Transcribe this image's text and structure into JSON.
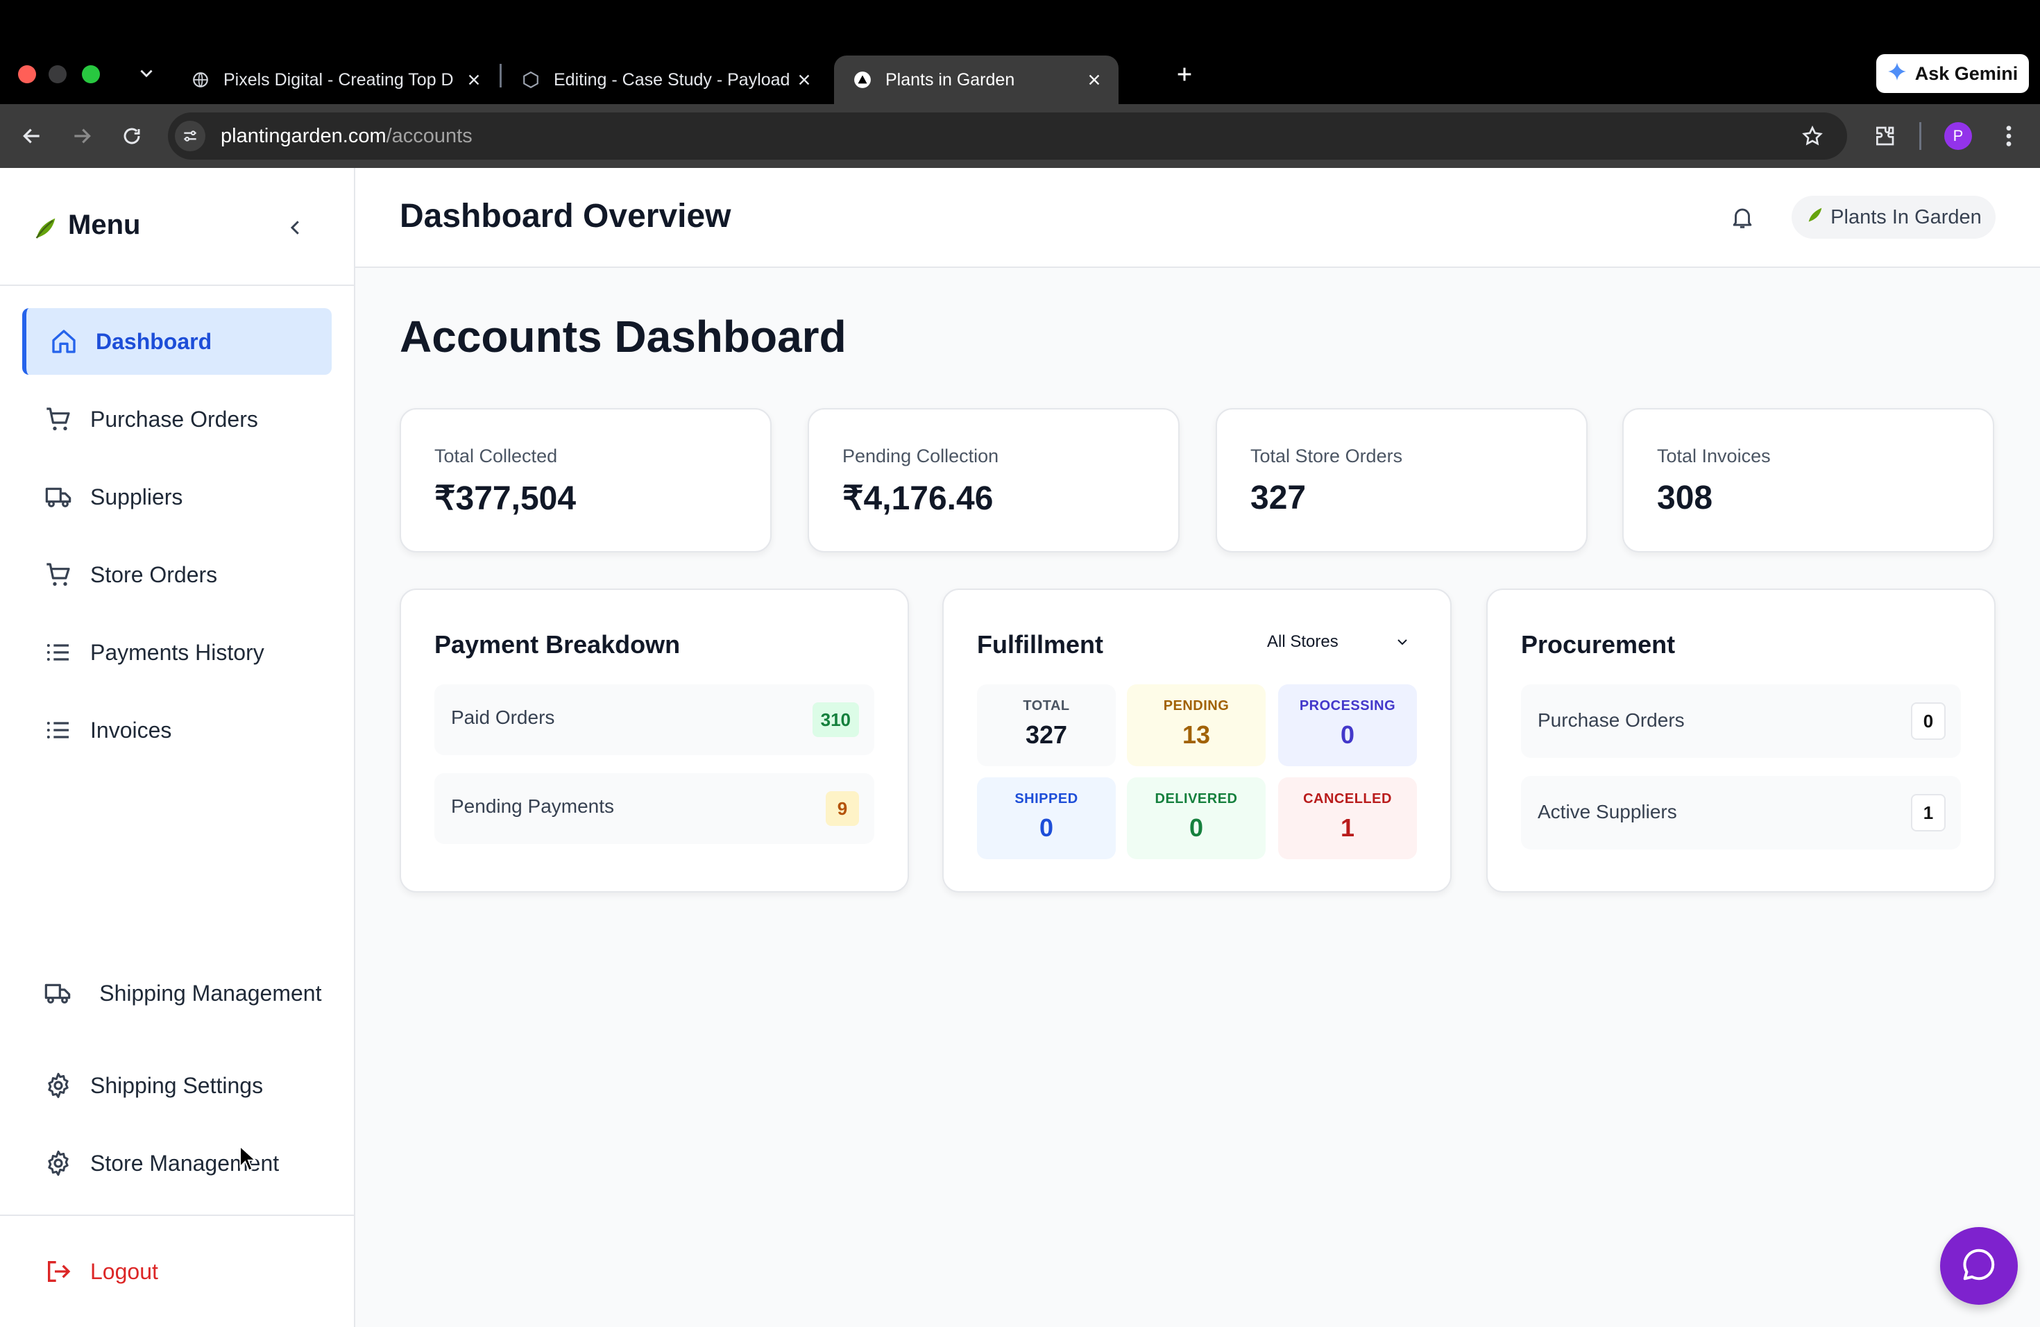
{
  "browser": {
    "tabs": [
      {
        "title": "Pixels Digital - Creating Top D",
        "active": false
      },
      {
        "title": "Editing - Case Study - Payload",
        "active": false
      },
      {
        "title": "Plants in Garden",
        "active": true
      }
    ],
    "url_host": "plantingarden.com",
    "url_path": "/accounts",
    "gemini_label": "Ask Gemini",
    "profile_initial": "P"
  },
  "sidebar": {
    "title": "Menu",
    "items": [
      {
        "label": "Dashboard",
        "icon": "home-icon",
        "active": true
      },
      {
        "label": "Purchase Orders",
        "icon": "cart-icon"
      },
      {
        "label": "Suppliers",
        "icon": "truck-icon"
      },
      {
        "label": "Store Orders",
        "icon": "cart-icon"
      },
      {
        "label": "Payments History",
        "icon": "list-icon"
      },
      {
        "label": "Invoices",
        "icon": "list-icon"
      },
      {
        "label": "Shipping Management",
        "icon": "truck-icon"
      },
      {
        "label": "Shipping Settings",
        "icon": "gear-icon"
      },
      {
        "label": "Store Management",
        "icon": "gear-icon"
      }
    ],
    "logout_label": "Logout"
  },
  "header": {
    "title": "Dashboard Overview",
    "store_name": "Plants In Garden"
  },
  "main": {
    "title": "Accounts Dashboard",
    "stats": [
      {
        "label": "Total Collected",
        "value": "₹377,504"
      },
      {
        "label": "Pending Collection",
        "value": "₹4,176.46"
      },
      {
        "label": "Total Store Orders",
        "value": "327"
      },
      {
        "label": "Total Invoices",
        "value": "308"
      }
    ],
    "payment_breakdown": {
      "title": "Payment Breakdown",
      "rows": [
        {
          "label": "Paid Orders",
          "value": "310"
        },
        {
          "label": "Pending Payments",
          "value": "9"
        }
      ]
    },
    "fulfillment": {
      "title": "Fulfillment",
      "store_filter": "All Stores",
      "tiles": [
        {
          "label": "TOTAL",
          "value": "327"
        },
        {
          "label": "PENDING",
          "value": "13"
        },
        {
          "label": "PROCESSING",
          "value": "0"
        },
        {
          "label": "SHIPPED",
          "value": "0"
        },
        {
          "label": "DELIVERED",
          "value": "0"
        },
        {
          "label": "CANCELLED",
          "value": "1"
        }
      ]
    },
    "procurement": {
      "title": "Procurement",
      "rows": [
        {
          "label": "Purchase Orders",
          "value": "0"
        },
        {
          "label": "Active Suppliers",
          "value": "1"
        }
      ]
    }
  },
  "colors": {
    "accent": "#2563eb",
    "active_bg": "#dbeafe",
    "logout": "#dc2626",
    "chat_button": "#7e22ce"
  }
}
